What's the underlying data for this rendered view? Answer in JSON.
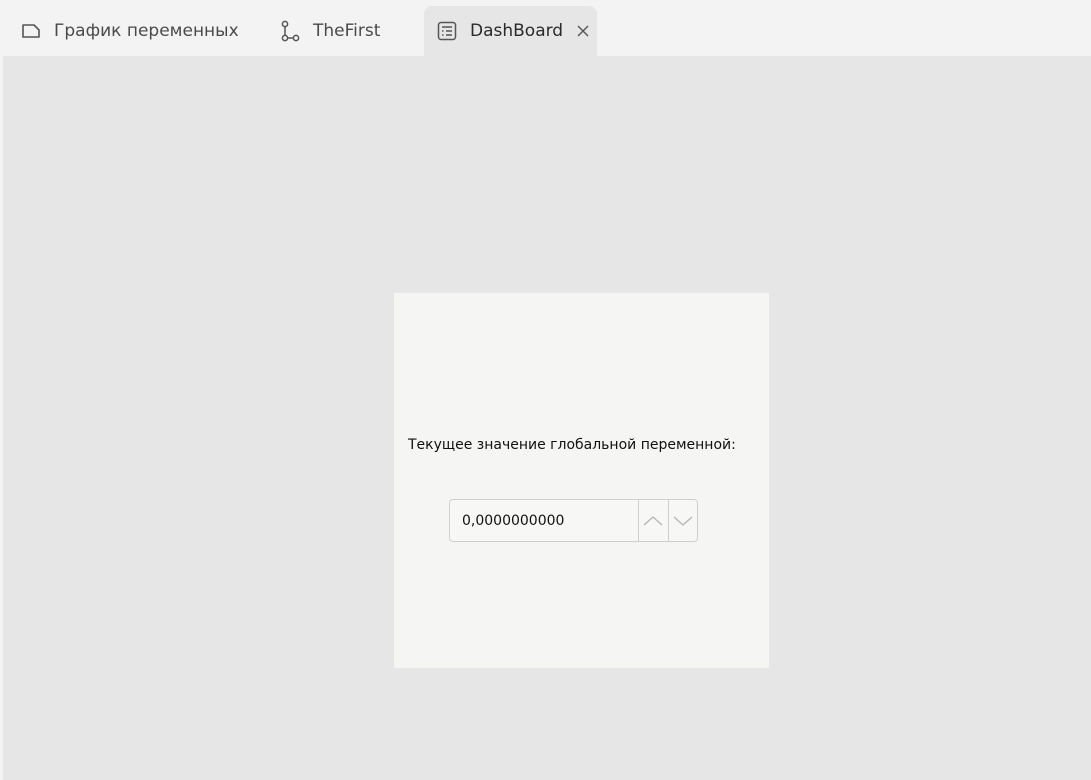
{
  "tabs": [
    {
      "label": "График переменных",
      "icon": "document-icon",
      "active": false
    },
    {
      "label": "TheFirst",
      "icon": "flow-icon",
      "active": false
    },
    {
      "label": "DashBoard",
      "icon": "dashboard-icon",
      "active": true
    }
  ],
  "dashboard": {
    "label": "Текущее значение глобальной переменной:",
    "value": "0,0000000000"
  },
  "colors": {
    "background": "#e6e6e6",
    "card": "#f5f5f3",
    "tabbar": "#f3f3f3"
  }
}
